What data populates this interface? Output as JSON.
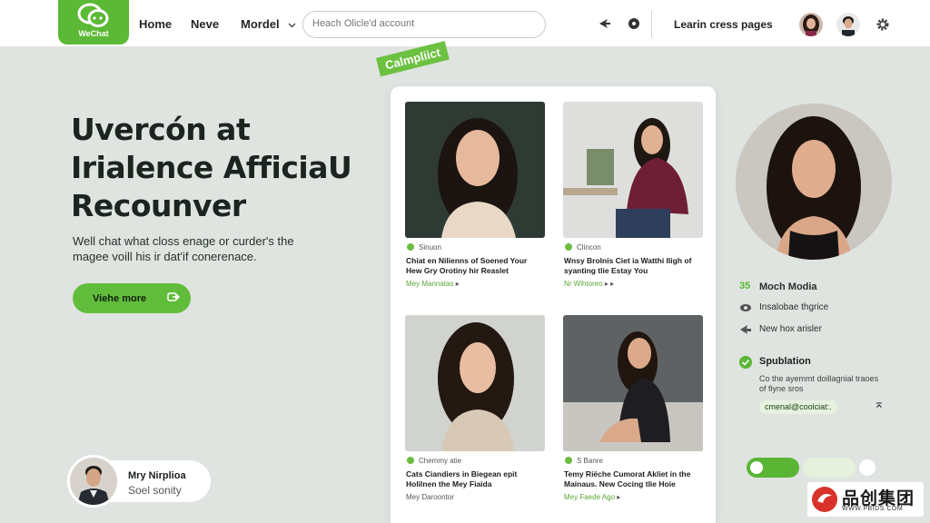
{
  "brand": {
    "logo_text": "WeChat"
  },
  "nav": {
    "home": "Home",
    "neve": "Neve",
    "model": "Mordel"
  },
  "search": {
    "placeholder": "Heach Olicle'd account"
  },
  "header": {
    "learn_link": "Learin cress pages"
  },
  "hero": {
    "title_lines": [
      "Uvercón at",
      "Irialence AfficiaU",
      "Recounver"
    ],
    "subtitle_lines": [
      "Well chat what closs enage or curder's the",
      "magee voill his ir dat'if conerenace."
    ],
    "cta_label": "Viehe more"
  },
  "badge": "Calmpliict",
  "profile": {
    "name": "Mry Nirplioa",
    "role": "Soel sonity"
  },
  "cards": [
    {
      "meta": "Sinuon",
      "title": "Chiat en Nilienns of Soened Your Hew Gry Orotiny hir Reaslet",
      "byline": "Mey Mannatas"
    },
    {
      "meta": "Clincon",
      "title": "Wnsy Brolnis Ciet ia Watthi Iligh of syanting tlie Estay You",
      "byline": "Nr Wihtoreo"
    },
    {
      "meta": "Chemmy atie",
      "title": "Cats Ciandiers in Biegean epit Holilnen the Mey Fiaida",
      "byline": "Mey Daroontor"
    },
    {
      "meta": "S Banre",
      "title": "Temy Riëche Cumorat Akliet in the Mainaus. New Cocing tlie Hoie",
      "byline": "Mey Faede Ago"
    }
  ],
  "side": {
    "items": [
      {
        "icon": "number-icon",
        "prefix": "35",
        "label": "Moch Modia"
      },
      {
        "icon": "eye-icon",
        "label": "Insalobae thgrice"
      },
      {
        "icon": "share-icon",
        "label": "New hox arisler"
      }
    ],
    "sub_head": "Spublation",
    "sub_desc": "Co the ayemmt doillagnial traoes of fiyne sros",
    "chip": "cmenal@coolciat:.",
    "chip_icon": "⌅"
  },
  "watermark": {
    "main": "品创集团",
    "sub": "WWW.PBIDS.COM"
  },
  "colors": {
    "accent": "#5bb935",
    "background": "#dfe4e0"
  }
}
